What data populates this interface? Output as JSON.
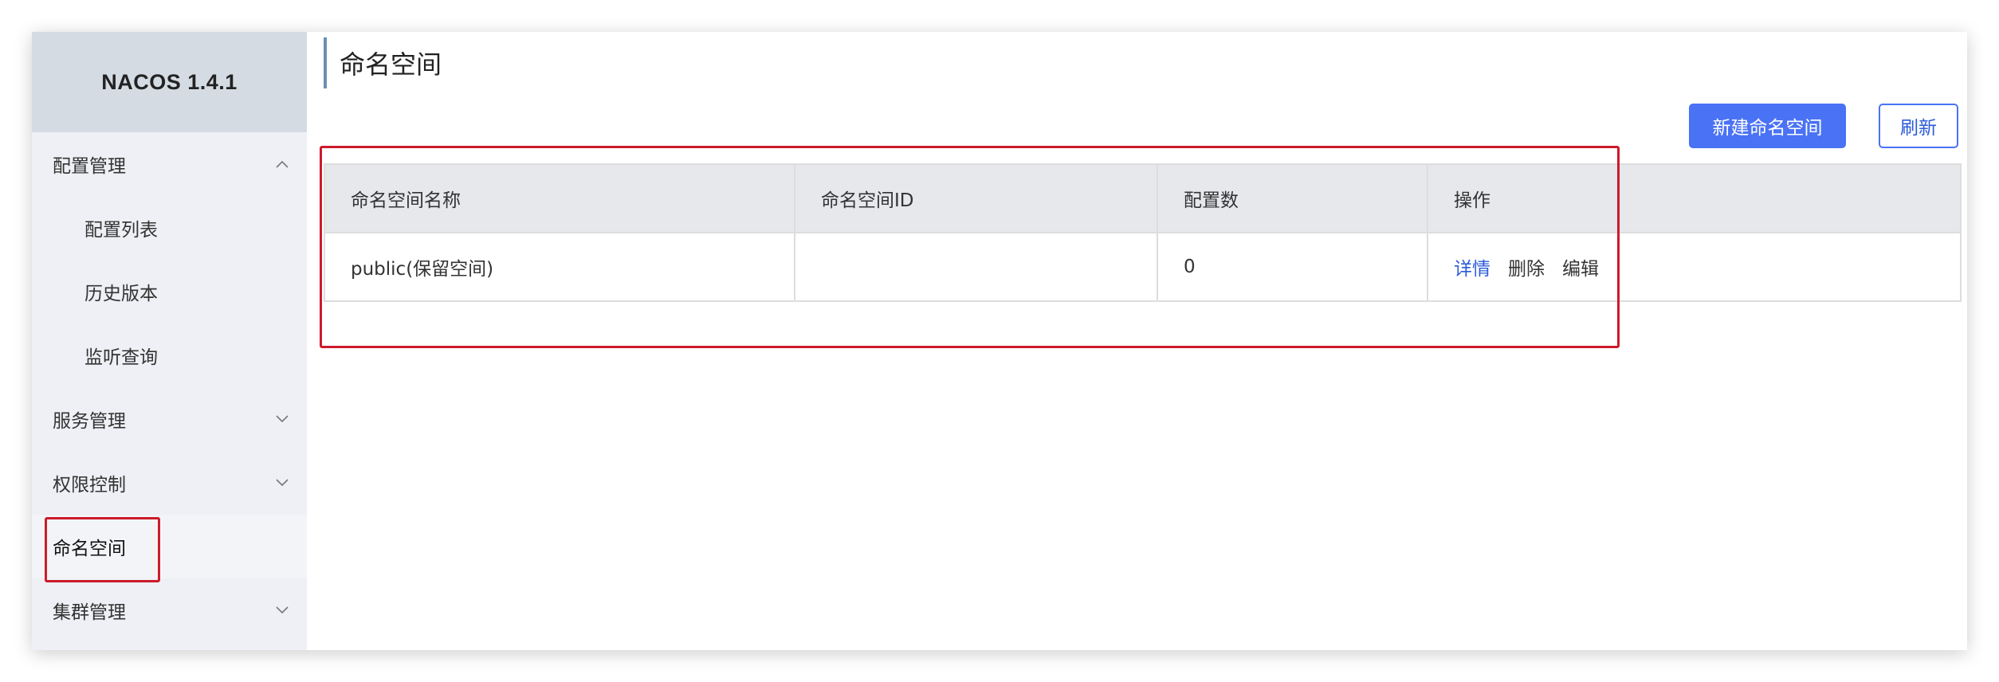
{
  "sidebar": {
    "brand": "NACOS 1.4.1",
    "items": [
      {
        "label": "配置管理",
        "chevron": "up"
      },
      {
        "label": "配置列表"
      },
      {
        "label": "历史版本"
      },
      {
        "label": "监听查询"
      },
      {
        "label": "服务管理",
        "chevron": "down"
      },
      {
        "label": "权限控制",
        "chevron": "down"
      },
      {
        "label": "命名空间",
        "active": true
      },
      {
        "label": "集群管理",
        "chevron": "down"
      }
    ]
  },
  "main": {
    "title": "命名空间",
    "new_button": "新建命名空间",
    "refresh_button": "刷新",
    "table": {
      "headers": [
        "命名空间名称",
        "命名空间ID",
        "配置数",
        "操作"
      ],
      "rows": [
        {
          "name": "public(保留空间)",
          "id": "",
          "count": "0",
          "ops": [
            "详情",
            "删除",
            "编辑"
          ]
        }
      ]
    }
  },
  "colors": {
    "primary": "#4a72f5",
    "link": "#2c5bd9",
    "highlight": "#cc1b2a",
    "sidebar_bg": "#eef0f5",
    "brand_bg": "#d4dbe3"
  }
}
